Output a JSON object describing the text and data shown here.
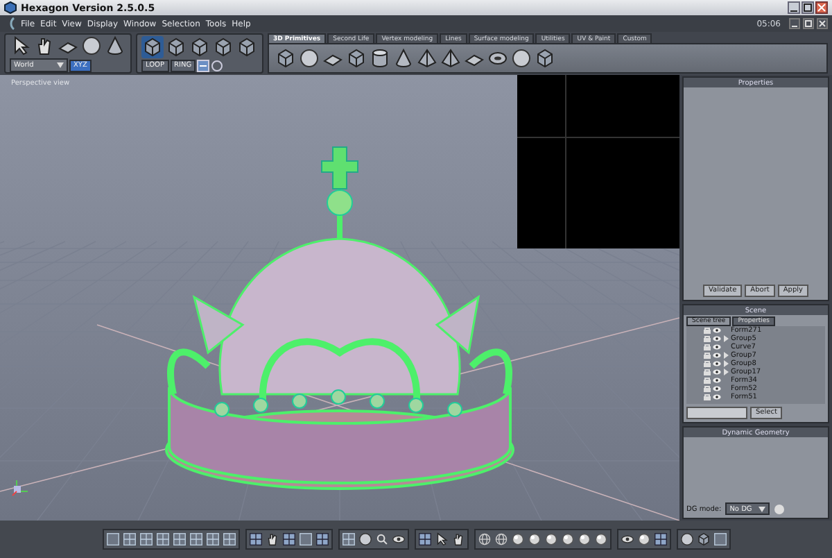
{
  "window": {
    "title": "Hexagon Version 2.5.0.5"
  },
  "menu": [
    "File",
    "Edit",
    "View",
    "Display",
    "Window",
    "Selection",
    "Tools",
    "Help"
  ],
  "clock": "05:06",
  "toolbar": {
    "coordinate_dropdown": "World",
    "axis_button": "XYZ",
    "loop_button": "LOOP",
    "ring_button": "RING"
  },
  "tabs": [
    {
      "label": "3D Primitives",
      "selected": true
    },
    {
      "label": "Second Life",
      "selected": false
    },
    {
      "label": "Vertex modeling",
      "selected": false
    },
    {
      "label": "Lines",
      "selected": false
    },
    {
      "label": "Surface modeling",
      "selected": false
    },
    {
      "label": "Utilities",
      "selected": false
    },
    {
      "label": "UV & Paint",
      "selected": false
    },
    {
      "label": "Custom",
      "selected": false
    }
  ],
  "viewport": {
    "label": "Perspective view"
  },
  "properties_panel": {
    "title": "Properties",
    "buttons": [
      "Validate",
      "Abort",
      "Apply"
    ]
  },
  "scene_panel": {
    "title": "Scene",
    "tabs": [
      {
        "label": "Scene tree",
        "selected": true
      },
      {
        "label": "Properties",
        "selected": false
      }
    ],
    "items": [
      {
        "label": "Form271",
        "kind": "form"
      },
      {
        "label": "Group5",
        "kind": "group"
      },
      {
        "label": "Curve7",
        "kind": "curve"
      },
      {
        "label": "Group7",
        "kind": "group"
      },
      {
        "label": "Group8",
        "kind": "group"
      },
      {
        "label": "Group17",
        "kind": "group"
      },
      {
        "label": "Form34",
        "kind": "form"
      },
      {
        "label": "Form52",
        "kind": "form"
      },
      {
        "label": "Form51",
        "kind": "form"
      }
    ],
    "select_button": "Select"
  },
  "dynamic_geometry_panel": {
    "title": "Dynamic Geometry",
    "mode_label": "DG mode:",
    "mode_value": "No DG"
  }
}
